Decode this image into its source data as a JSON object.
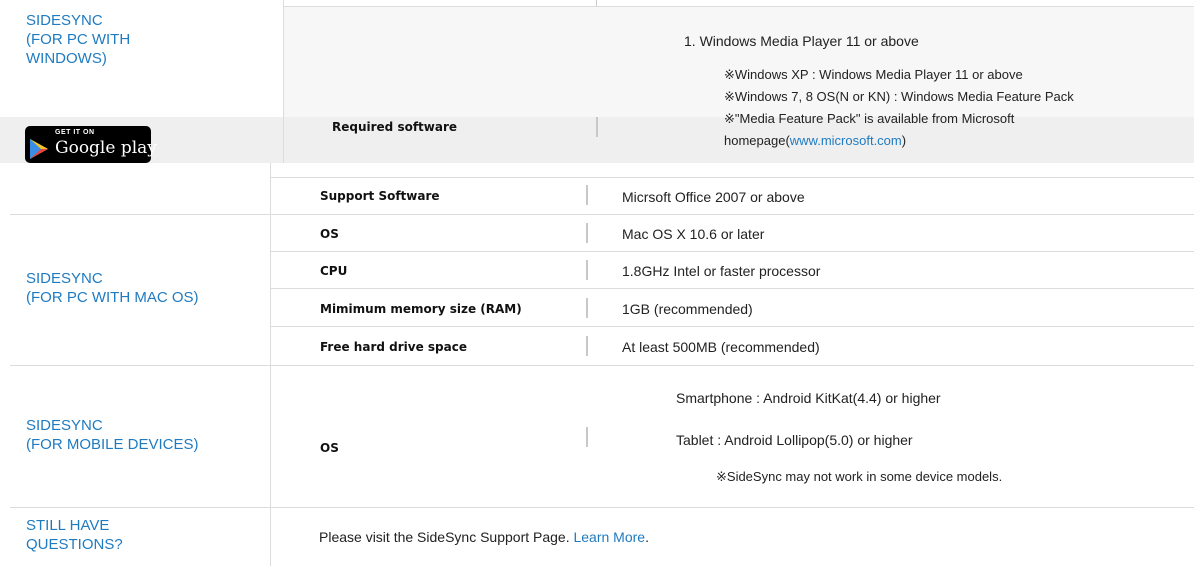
{
  "sections": {
    "windows": {
      "title_line1": "SIDESYNC",
      "title_line2": "(FOR PC WITH",
      "title_line3": "WINDOWS)",
      "required_software": {
        "label": "Required software",
        "item1": "1. Windows Media Player 11 or above",
        "note1": "※Windows XP : Windows Media Player 11 or above",
        "note2": "※Windows 7, 8 OS(N or KN) : Windows Media Feature Pack",
        "note3": "※\"Media Feature Pack\" is available from Microsoft",
        "note4_prefix": "homepage(",
        "note4_link": "www.microsoft.com",
        "note4_suffix": ")"
      },
      "support_software": {
        "label": "Support Software",
        "value": "Micrsoft Office 2007 or above"
      }
    },
    "mac": {
      "title_line1": "SIDESYNC",
      "title_line2": "(FOR PC WITH MAC OS)",
      "rows": [
        {
          "label": "OS",
          "value": "Mac OS X 10.6 or later"
        },
        {
          "label": "CPU",
          "value": "1.8GHz Intel or faster processor"
        },
        {
          "label": "Mimimum memory size (RAM)",
          "value": "1GB (recommended)"
        },
        {
          "label": "Free hard drive space",
          "value": "At least 500MB (recommended)"
        }
      ]
    },
    "mobile": {
      "title_line1": "SIDESYNC",
      "title_line2": "(FOR MOBILE DEVICES)",
      "label": "OS",
      "smartphone": "Smartphone : Android KitKat(4.4) or higher",
      "tablet": "Tablet : Android Lollipop(5.0) or higher",
      "note": "※SideSync may not work in some device models."
    },
    "questions": {
      "title_line1": "STILL HAVE",
      "title_line2": "QUESTIONS?",
      "text": "Please visit the SideSync Support Page. ",
      "link": "Learn More",
      "suffix": "."
    }
  },
  "google_play": {
    "small": "GET IT ON",
    "big": "Google play"
  },
  "colors": {
    "accent": "#1f7bc1",
    "gray_band": "#f3f3f3"
  }
}
